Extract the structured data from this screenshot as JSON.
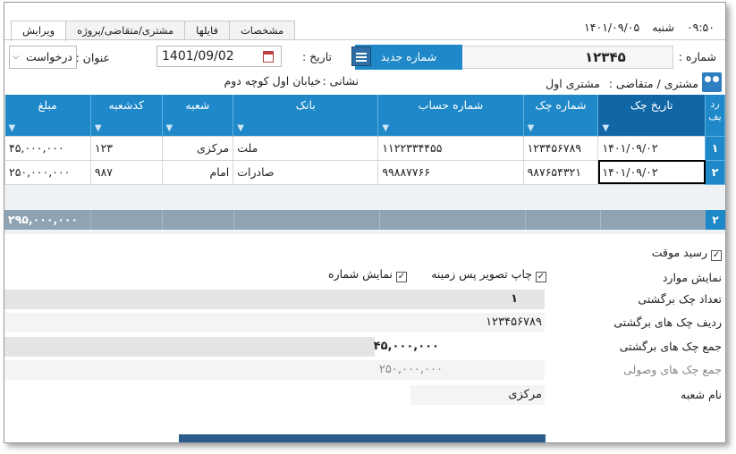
{
  "clock": {
    "time": "۰۹:۵۰",
    "day": "شنبه",
    "date": "۱۴۰۱/۰۹/۰۵"
  },
  "tabs": [
    {
      "label": "ویرایش",
      "active": true
    },
    {
      "label": "مشتری/متقاضی/پروژه",
      "active": false
    },
    {
      "label": "فایلها",
      "active": false
    },
    {
      "label": "مشخصات",
      "active": false
    }
  ],
  "header": {
    "number_label": "شماره :",
    "number_value": "۱۲۳۴۵",
    "new_number_button": "شماره جدید",
    "date_label": "تاریخ :",
    "date_value": "1401/09/02",
    "subject_label": "عنوان :",
    "subject_value": "درخواست",
    "customer_label": "مشتری / متقاضی :",
    "customer_value": "مشتری اول",
    "address_label": "نشانی :",
    "address_value": "خیابان اول کوچه دوم"
  },
  "grid": {
    "row_header": "رد یف",
    "columns": [
      "تاریخ چک",
      "شماره چک",
      "شماره حساب",
      "بانک",
      "شعبه",
      "کدشعبه",
      "مبلغ"
    ],
    "rows": [
      {
        "n": "۱",
        "cells": [
          "۱۴۰۱/۰۹/۰۲",
          "۱۲۳۴۵۶۷۸۹",
          "۱۱۲۲۳۳۴۴۵۵",
          "ملت",
          "مرکزی",
          "۱۲۳",
          "۴۵,۰۰۰,۰۰۰"
        ]
      },
      {
        "n": "۲",
        "cells": [
          "۱۴۰۱/۰۹/۰۲",
          "۹۸۷۶۵۴۳۲۱",
          "۹۹۸۸۷۷۶۶",
          "صادرات",
          "امام",
          "۹۸۷",
          "۲۵۰,۰۰۰,۰۰۰"
        ]
      }
    ],
    "summary_count": "۲",
    "summary_total": "۲۹۵,۰۰۰,۰۰۰"
  },
  "options": {
    "temp_receipt": "رسید موقت",
    "show_items": "نمایش موارد",
    "print_bg": "چاپ تصویر پس زمینه",
    "show_number": "نمایش شماره"
  },
  "stats": [
    {
      "label": "تعداد چک برگشتی",
      "value": "۱"
    },
    {
      "label": "ردیف چک های برگشتی",
      "value": "۱۲۳۴۵۶۷۸۹"
    },
    {
      "label": "جمع چک های برگشتی",
      "value": "۴۵,۰۰۰,۰۰۰"
    },
    {
      "label": "جمع چک های وصولی",
      "value": "۲۵۰,۰۰۰,۰۰۰"
    },
    {
      "label": "نام شعبه",
      "value": "مرکزی"
    }
  ],
  "colors": {
    "accent": "#1e88c8",
    "header_dark": "#1167a6",
    "summary": "#8ea4b4"
  }
}
